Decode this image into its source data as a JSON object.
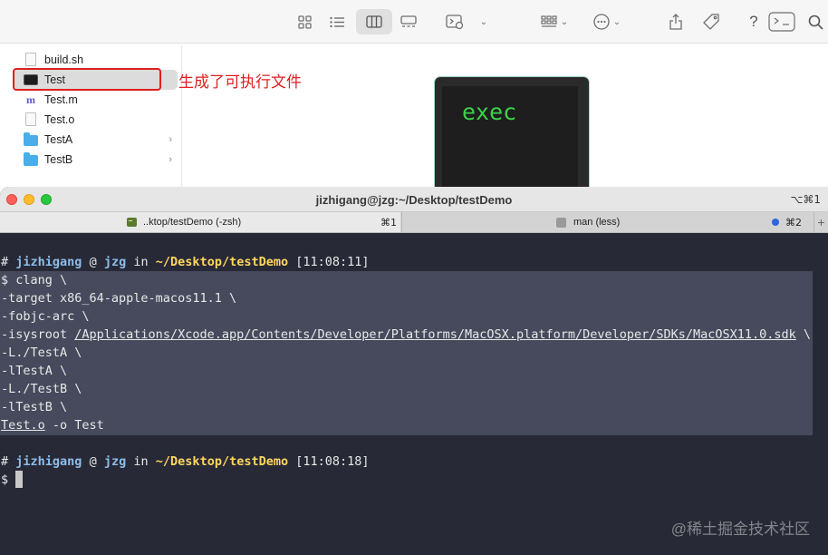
{
  "finder": {
    "toolbar": {
      "icons": [
        "icon-view-icon",
        "list-view-icon",
        "column-view-icon",
        "gallery-view-icon",
        "quick-look-icon",
        "group-icon",
        "action-icon",
        "share-icon",
        "tag-icon",
        "help-icon",
        "terminal-icon",
        "search-icon"
      ],
      "help_glyph": "?"
    },
    "files": [
      {
        "name": "build.sh",
        "icon": "document-icon"
      },
      {
        "name": "Test",
        "icon": "executable-icon",
        "selected": true
      },
      {
        "name": "Test.m",
        "icon": "objc-file-icon"
      },
      {
        "name": "Test.o",
        "icon": "document-icon"
      },
      {
        "name": "TestA",
        "icon": "folder-icon",
        "has_children": true
      },
      {
        "name": "TestB",
        "icon": "folder-icon",
        "has_children": true
      }
    ],
    "annotation": "生成了可执行文件",
    "annotation_color": "#e02020",
    "preview_text": "exec",
    "chevron_glyph": "›",
    "m_glyph": "m"
  },
  "terminal": {
    "title": "jizhigang@jzg:~/Desktop/testDemo",
    "shortcut": "⌥⌘1",
    "tabs": [
      {
        "label": "..ktop/testDemo (-zsh)",
        "shortcut": "⌘1",
        "active": true
      },
      {
        "label": "man (less)",
        "shortcut": "⌘2",
        "active": false
      }
    ],
    "add_tab_glyph": "+",
    "prompt1": {
      "hash": "#",
      "user": "jizhigang",
      "at": "@",
      "host": "jzg",
      "in": "in",
      "path": "~/Desktop/testDemo",
      "time": "[11:08:11]"
    },
    "command_lines": [
      "$ clang \\",
      "-target x86_64-apple-macos11.1 \\",
      "-fobjc-arc \\",
      "-isysroot ",
      "-L./TestA \\",
      "-lTestA \\",
      "-L./TestB \\",
      "-lTestB \\",
      ""
    ],
    "sysroot_path": "/Applications/Xcode.app/Contents/Developer/Platforms/MacOSX.platform/Developer/SDKs/MacOSX11.0.sdk",
    "sysroot_suffix": " \\",
    "last_cmd_file": "Test.o",
    "last_cmd_rest": " -o Test",
    "prompt2": {
      "hash": "#",
      "user": "jizhigang",
      "at": "@",
      "host": "jzg",
      "in": "in",
      "path": "~/Desktop/testDemo",
      "time": "[11:08:18]"
    },
    "prompt_symbol": "$",
    "colors": {
      "background": "#272936",
      "selection": "#464a5c",
      "user": "#8fbde8",
      "path": "#ffd75f"
    }
  },
  "watermark": "@稀土掘金技术社区"
}
